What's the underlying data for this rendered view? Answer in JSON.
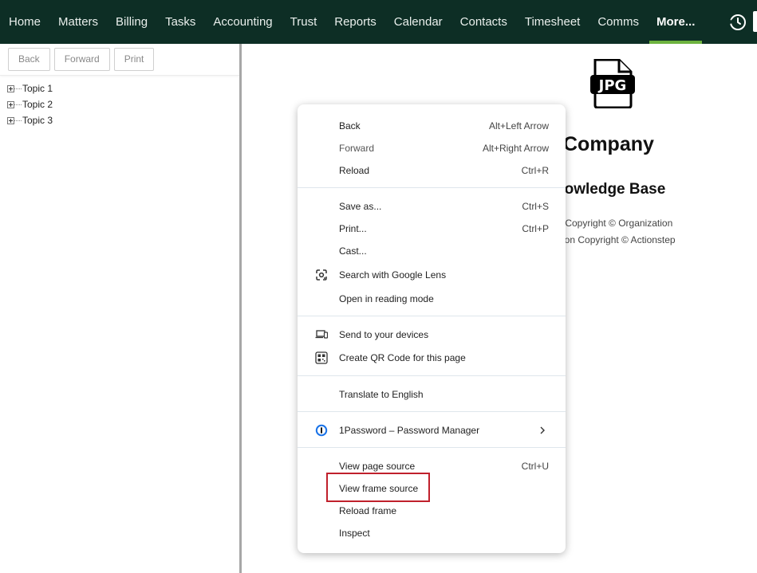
{
  "nav": {
    "items": [
      {
        "label": "Home"
      },
      {
        "label": "Matters"
      },
      {
        "label": "Billing"
      },
      {
        "label": "Tasks"
      },
      {
        "label": "Accounting"
      },
      {
        "label": "Trust"
      },
      {
        "label": "Reports"
      },
      {
        "label": "Calendar"
      },
      {
        "label": "Contacts"
      },
      {
        "label": "Timesheet"
      },
      {
        "label": "Comms"
      },
      {
        "label": "More..."
      }
    ],
    "active": "More...",
    "right_icon": "history-icon",
    "bg_color": "#0d2e25",
    "active_underline_color": "#6db33f"
  },
  "left_pane": {
    "toolbar": {
      "back_label": "Back",
      "forward_label": "Forward",
      "print_label": "Print"
    },
    "tree": [
      {
        "label": "Topic 1"
      },
      {
        "label": "Topic 2"
      },
      {
        "label": "Topic 3"
      }
    ]
  },
  "content": {
    "file_icon": "jpg-file-icon",
    "file_icon_text": "JPG",
    "company": "Company",
    "knowledge_base": "nowledge Base",
    "copyright_line1": "nt Copyright © Organization",
    "copyright_line2": "ation Copyright © Actionstep"
  },
  "context_menu": {
    "items": [
      {
        "label": "Back",
        "shortcut": "Alt+Left Arrow"
      },
      {
        "label": "Forward",
        "shortcut": "Alt+Right Arrow",
        "disabled": true
      },
      {
        "label": "Reload",
        "shortcut": "Ctrl+R"
      },
      {
        "label": "Save as...",
        "shortcut": "Ctrl+S"
      },
      {
        "label": "Print...",
        "shortcut": "Ctrl+P"
      },
      {
        "label": "Cast...",
        "shortcut": ""
      },
      {
        "label": "Search with Google Lens",
        "shortcut": "",
        "icon": "google-lens-icon"
      },
      {
        "label": "Open in reading mode",
        "shortcut": ""
      },
      {
        "label": "Send to your devices",
        "shortcut": "",
        "icon": "devices-icon"
      },
      {
        "label": "Create QR Code for this page",
        "shortcut": "",
        "icon": "qr-code-icon"
      },
      {
        "label": "Translate to English",
        "shortcut": ""
      },
      {
        "label": "1Password – Password Manager",
        "shortcut": "",
        "icon": "1password-icon",
        "submenu": true
      },
      {
        "label": "View page source",
        "shortcut": "Ctrl+U"
      },
      {
        "label": "View frame source",
        "shortcut": "",
        "highlighted": true
      },
      {
        "label": "Reload frame",
        "shortcut": ""
      },
      {
        "label": "Inspect",
        "shortcut": ""
      }
    ],
    "highlight_color": "#c0202c"
  }
}
